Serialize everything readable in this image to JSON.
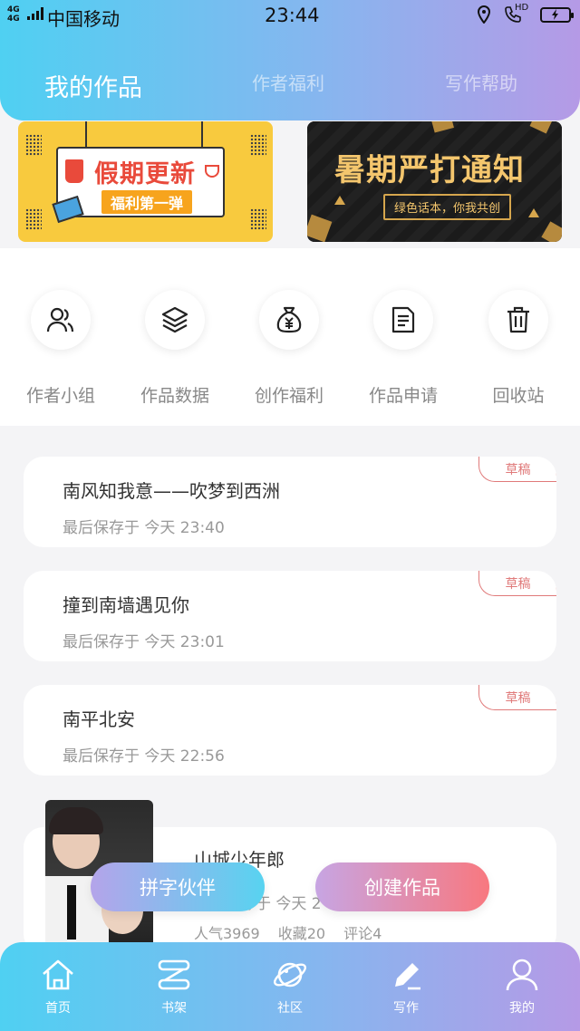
{
  "statusbar": {
    "network": "4G 4G",
    "carrier": "中国移动",
    "time": "23:44",
    "hd": "HD"
  },
  "header": {
    "tabs": [
      {
        "label": "我的作品",
        "active": true
      },
      {
        "label": "作者福利",
        "active": false
      },
      {
        "label": "写作帮助",
        "active": false
      }
    ]
  },
  "banners": [
    {
      "title": "假期更新",
      "subtitle": "福利第一弹",
      "bg": "#f8ca3e"
    },
    {
      "title": "暑期严打通知",
      "subtitle": "绿色话本，你我共创",
      "bg": "#161616"
    }
  ],
  "actions": [
    {
      "label": "作者小组",
      "icon": "users-icon"
    },
    {
      "label": "作品数据",
      "icon": "layers-icon"
    },
    {
      "label": "创作福利",
      "icon": "money-bag-icon"
    },
    {
      "label": "作品申请",
      "icon": "document-icon"
    },
    {
      "label": "回收站",
      "icon": "trash-icon"
    }
  ],
  "works": [
    {
      "title": "南风知我意——吹梦到西洲",
      "saved": "最后保存于 今天 23:40",
      "badge": "草稿"
    },
    {
      "title": "撞到南墙遇见你",
      "saved": "最后保存于 今天 23:01",
      "badge": "草稿"
    },
    {
      "title": "南平北安",
      "saved": "最后保存于 今天 22:56",
      "badge": "草稿"
    }
  ],
  "featured": {
    "title": "山城少年郎",
    "saved": "最后保存于 今天 2",
    "popularity": "人气3969",
    "favorites": "收藏20",
    "comments": "评论4"
  },
  "floating": {
    "pin_label": "拼字伙伴",
    "create_label": "创建作品"
  },
  "bottomnav": [
    {
      "label": "首页",
      "icon": "home-icon"
    },
    {
      "label": "书架",
      "icon": "bookshelf-icon"
    },
    {
      "label": "社区",
      "icon": "planet-icon"
    },
    {
      "label": "写作",
      "icon": "pen-icon"
    },
    {
      "label": "我的",
      "icon": "user-icon"
    }
  ],
  "colors": {
    "gradient_start": "#4fd0f2",
    "gradient_end": "#b59ae6",
    "draft_red": "#e07a7a",
    "create_pink": "#f8787f"
  }
}
